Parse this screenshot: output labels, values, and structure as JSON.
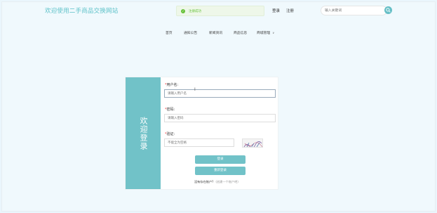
{
  "header": {
    "site_title": "欢迎使用二手商品交换网站",
    "toast_text": "注册成功",
    "login_label": "登录",
    "register_label": "注册",
    "search_placeholder": "输入关键词"
  },
  "nav": {
    "items": [
      {
        "label": "首页"
      },
      {
        "label": "通知公告"
      },
      {
        "label": "新闻资讯"
      },
      {
        "label": "商品信息"
      },
      {
        "label": "商城管理"
      }
    ]
  },
  "login": {
    "side_title": "欢迎登录",
    "username_label": "用户名:",
    "username_placeholder": "请输入用户名",
    "password_label": "密码:",
    "password_placeholder": "请输入密码",
    "captcha_label": "验证:",
    "captcha_placeholder": "不能全为空格",
    "login_button": "登录",
    "reset_button": "重新登录",
    "register_prompt": "没有存在账户?",
    "register_link": "(创建一个账户吧)"
  },
  "colors": {
    "accent": "#71c2c8",
    "title": "#5ec2c9",
    "success": "#67c23a"
  }
}
